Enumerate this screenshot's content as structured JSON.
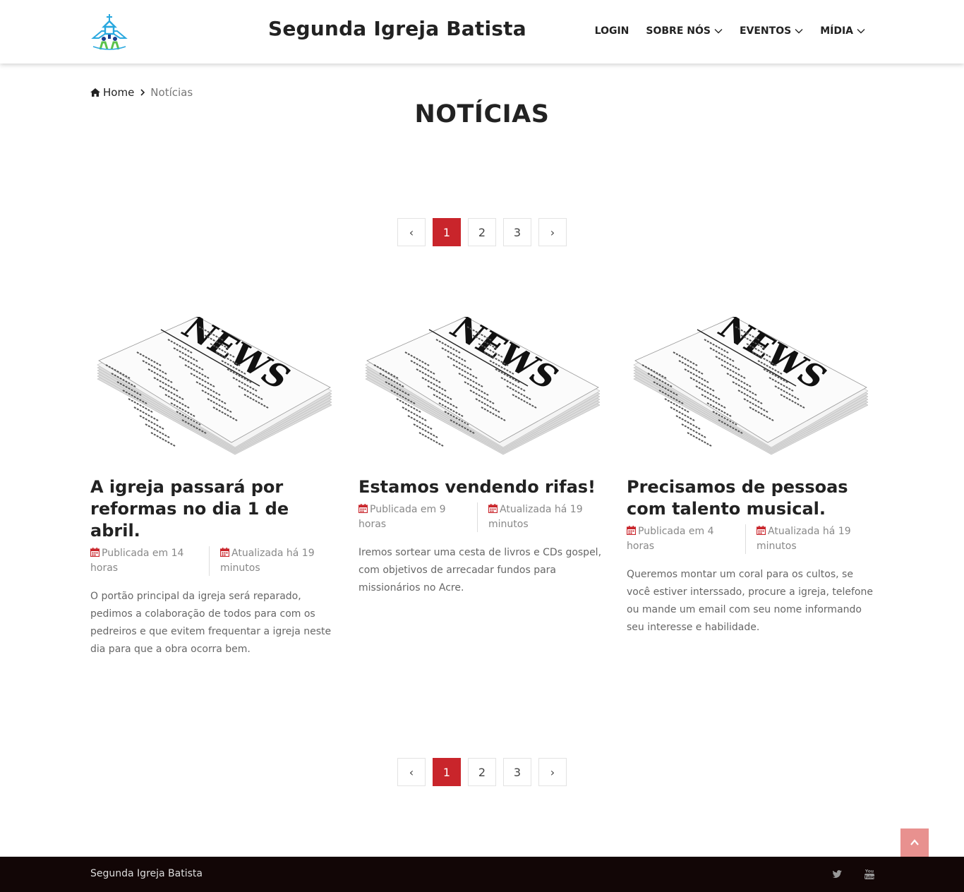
{
  "header": {
    "title": "Segunda Igreja Batista",
    "logo_icon": "church-logo-icon",
    "nav": [
      {
        "label": "LOGIN",
        "dropdown": false
      },
      {
        "label": "SOBRE NÓS",
        "dropdown": true
      },
      {
        "label": "EVENTOS",
        "dropdown": true
      },
      {
        "label": "MÍDIA",
        "dropdown": true
      }
    ]
  },
  "breadcrumb": {
    "home_icon": "home-icon",
    "home": "Home",
    "separator_icon": "chevron-right-icon",
    "current": "Notícias"
  },
  "page_title": "NOTÍCIAS",
  "pagination": {
    "prev": "‹",
    "pages": [
      "1",
      "2",
      "3"
    ],
    "active_page": "1",
    "next": "›"
  },
  "articles": [
    {
      "image_icon": "newspaper-image",
      "title": "A igreja passará por reformas no dia 1 de abril.",
      "published": "Publicada em 14 horas",
      "updated": "Atualizada há 19 minutos",
      "text": "O portão principal da igreja será reparado, pedimos a colaboração de todos para com os pedreiros e que evitem frequentar a igreja neste dia para que a obra ocorra bem."
    },
    {
      "image_icon": "newspaper-image",
      "title": "Estamos vendendo rifas!",
      "published": "Publicada em 9 horas",
      "updated": "Atualizada há 19 minutos",
      "text": "Iremos sortear uma cesta de livros e CDs gospel, com objetivos de arrecadar fundos para missionários no Acre."
    },
    {
      "image_icon": "newspaper-image",
      "title": "Precisamos de pessoas com talento musical.",
      "published": "Publicada em 4 horas",
      "updated": "Atualizada há 19 minutos",
      "text": "Queremos montar um coral para os cultos, se você estiver interssado, procure a igreja, telefone ou mande um email com seu nome informando seu interesse e habilidade."
    }
  ],
  "back_to_top_icon": "chevron-up-icon",
  "footer": {
    "text": "Segunda Igreja Batista",
    "social": [
      "twitter-icon",
      "youtube-icon"
    ]
  },
  "colors": {
    "accent": "#c9252b",
    "back_to_top": "#e8918f",
    "footer_bg": "#120606",
    "calendar_icon": "#c9252b"
  }
}
